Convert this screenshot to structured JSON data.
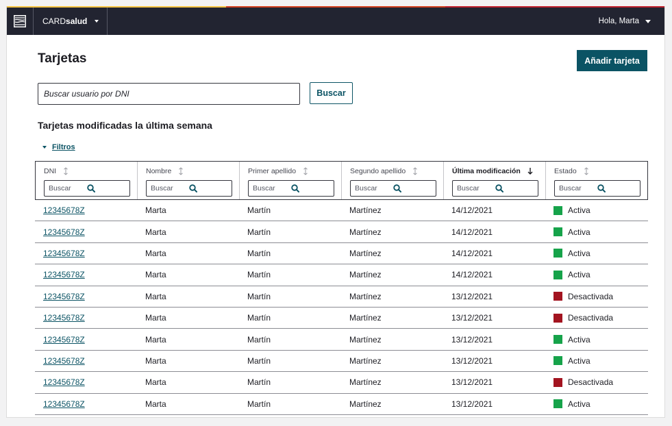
{
  "colors": {
    "stripe": [
      "#f5c342",
      "#d13f1e",
      "#c0202c"
    ],
    "topbar": "#222431",
    "accent": "#0b5364",
    "status_active": "#16a34a",
    "status_inactive": "#a31420"
  },
  "topbar": {
    "app_prefix": "CARD",
    "app_bold": "salud",
    "user_greeting": "Hola, Marta"
  },
  "page": {
    "title": "Tarjetas",
    "add_button": "Añadir tarjeta",
    "search_placeholder": "Buscar usuario por DNI",
    "search_button": "Buscar",
    "section_title": "Tarjetas modificadas la última semana",
    "filters_label": "Filtros"
  },
  "table": {
    "columns": [
      {
        "label": "DNI",
        "search_placeholder": "Buscar",
        "sort": "none"
      },
      {
        "label": "Nombre",
        "search_placeholder": "Buscar",
        "sort": "none"
      },
      {
        "label": "Primer apellido",
        "search_placeholder": "Buscar",
        "sort": "none"
      },
      {
        "label": "Segundo apellido",
        "search_placeholder": "Buscar",
        "sort": "none"
      },
      {
        "label": "Última modificación",
        "search_placeholder": "Buscar",
        "sort": "desc"
      },
      {
        "label": "Estado",
        "search_placeholder": "Buscar",
        "sort": "none"
      }
    ],
    "rows": [
      {
        "dni": "12345678Z",
        "nombre": "Marta",
        "apellido1": "Martín",
        "apellido2": "Martínez",
        "fecha": "14/12/2021",
        "estado": "Activa",
        "activo": true
      },
      {
        "dni": "12345678Z",
        "nombre": "Marta",
        "apellido1": "Martín",
        "apellido2": "Martínez",
        "fecha": "14/12/2021",
        "estado": "Activa",
        "activo": true
      },
      {
        "dni": "12345678Z",
        "nombre": "Marta",
        "apellido1": "Martín",
        "apellido2": "Martínez",
        "fecha": "14/12/2021",
        "estado": "Activa",
        "activo": true
      },
      {
        "dni": "12345678Z",
        "nombre": "Marta",
        "apellido1": "Martín",
        "apellido2": "Martínez",
        "fecha": "14/12/2021",
        "estado": "Activa",
        "activo": true
      },
      {
        "dni": "12345678Z",
        "nombre": "Marta",
        "apellido1": "Martín",
        "apellido2": "Martínez",
        "fecha": "13/12/2021",
        "estado": "Desactivada",
        "activo": false
      },
      {
        "dni": "12345678Z",
        "nombre": "Marta",
        "apellido1": "Martín",
        "apellido2": "Martínez",
        "fecha": "13/12/2021",
        "estado": "Desactivada",
        "activo": false
      },
      {
        "dni": "12345678Z",
        "nombre": "Marta",
        "apellido1": "Martín",
        "apellido2": "Martínez",
        "fecha": "13/12/2021",
        "estado": "Activa",
        "activo": true
      },
      {
        "dni": "12345678Z",
        "nombre": "Marta",
        "apellido1": "Martín",
        "apellido2": "Martínez",
        "fecha": "13/12/2021",
        "estado": "Activa",
        "activo": true
      },
      {
        "dni": "12345678Z",
        "nombre": "Marta",
        "apellido1": "Martín",
        "apellido2": "Martínez",
        "fecha": "13/12/2021",
        "estado": "Desactivada",
        "activo": false
      },
      {
        "dni": "12345678Z",
        "nombre": "Marta",
        "apellido1": "Martín",
        "apellido2": "Martínez",
        "fecha": "13/12/2021",
        "estado": "Activa",
        "activo": true
      }
    ]
  }
}
